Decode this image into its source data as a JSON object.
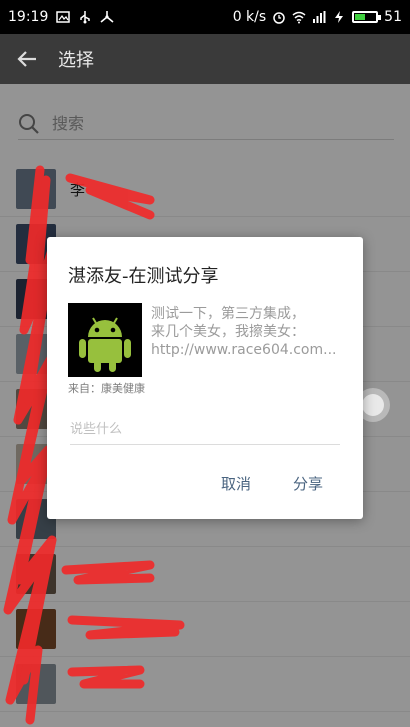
{
  "status_bar": {
    "time": "19:19",
    "speed": "0 k/s",
    "battery_level": "51",
    "battery_fraction": 0.51
  },
  "app_bar": {
    "title": "选择"
  },
  "search": {
    "placeholder": "搜索"
  },
  "contacts": [
    {
      "name": "李",
      "avatar_color": "#6f7f92"
    },
    {
      "name": "",
      "avatar_color": "#3d4f6b"
    },
    {
      "name": "",
      "avatar_color": "#2f3c53"
    },
    {
      "name": "",
      "avatar_color": "#9aa5b0"
    },
    {
      "name": "",
      "avatar_color": "#8c7d6e"
    },
    {
      "name": "",
      "avatar_color": "#c0b6a8"
    },
    {
      "name": "",
      "avatar_color": "#5e6d7a"
    },
    {
      "name": "",
      "avatar_color": "#6a5a4a"
    },
    {
      "name": "",
      "avatar_color": "#7a4a2a"
    },
    {
      "name": "",
      "avatar_color": "#8a949d"
    }
  ],
  "dialog": {
    "title": "湛添友-在测试分享",
    "share_line1": "测试一下，第三方集成，",
    "share_line2": "来几个美女，我擦美女：",
    "share_line3": "http://www.race604.com...",
    "from_text": "来自：康美健康",
    "comment_placeholder": "说些什么",
    "cancel_label": "取消",
    "share_label": "分享"
  },
  "colors": {
    "app_bar": "#3a3a3a",
    "accent_button": "#4a6480",
    "android_green": "#97c03d",
    "scribble_red": "#f02a2a"
  }
}
